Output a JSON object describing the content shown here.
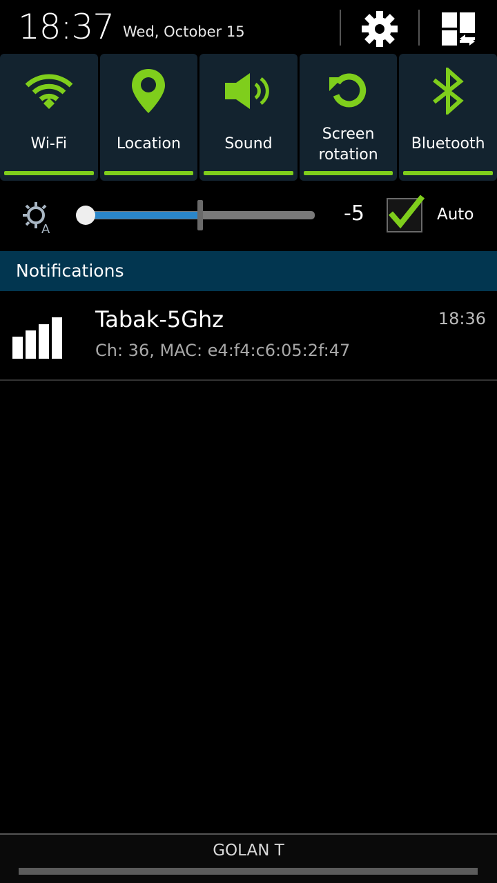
{
  "status": {
    "time": "18:37",
    "date": "Wed, October 15"
  },
  "header_icons": [
    {
      "name": "settings",
      "icon": "gear-icon"
    },
    {
      "name": "edit-quick-settings",
      "icon": "grid-swap-icon"
    }
  ],
  "quick_toggles": [
    {
      "label": "Wi-Fi",
      "icon": "wifi-icon",
      "enabled": true
    },
    {
      "label": "Location",
      "icon": "location-pin-icon",
      "enabled": true
    },
    {
      "label": "Sound",
      "icon": "speaker-icon",
      "enabled": true
    },
    {
      "label": "Screen rotation",
      "label_line1": "Screen",
      "label_line2": "rotation",
      "icon": "rotate-icon",
      "enabled": true
    },
    {
      "label": "Bluetooth",
      "icon": "bluetooth-icon",
      "enabled": true
    }
  ],
  "brightness": {
    "icon": "auto-brightness-icon",
    "value": "-5",
    "level_fraction": 0.5,
    "auto_label": "Auto",
    "auto_checked": true
  },
  "notifications": {
    "header": "Notifications",
    "items": [
      {
        "icon": "signal-bars-icon",
        "title": "Tabak-5Ghz",
        "subtitle": "Ch: 36, MAC: e4:f4:c6:05:2f:47",
        "time": "18:36"
      }
    ]
  },
  "footer": {
    "carrier": "GOLAN T"
  },
  "colors": {
    "accent_green": "#7fce1c",
    "tile_bg": "#13232f",
    "header_blue": "#023650",
    "slider_blue": "#2a86c9"
  }
}
